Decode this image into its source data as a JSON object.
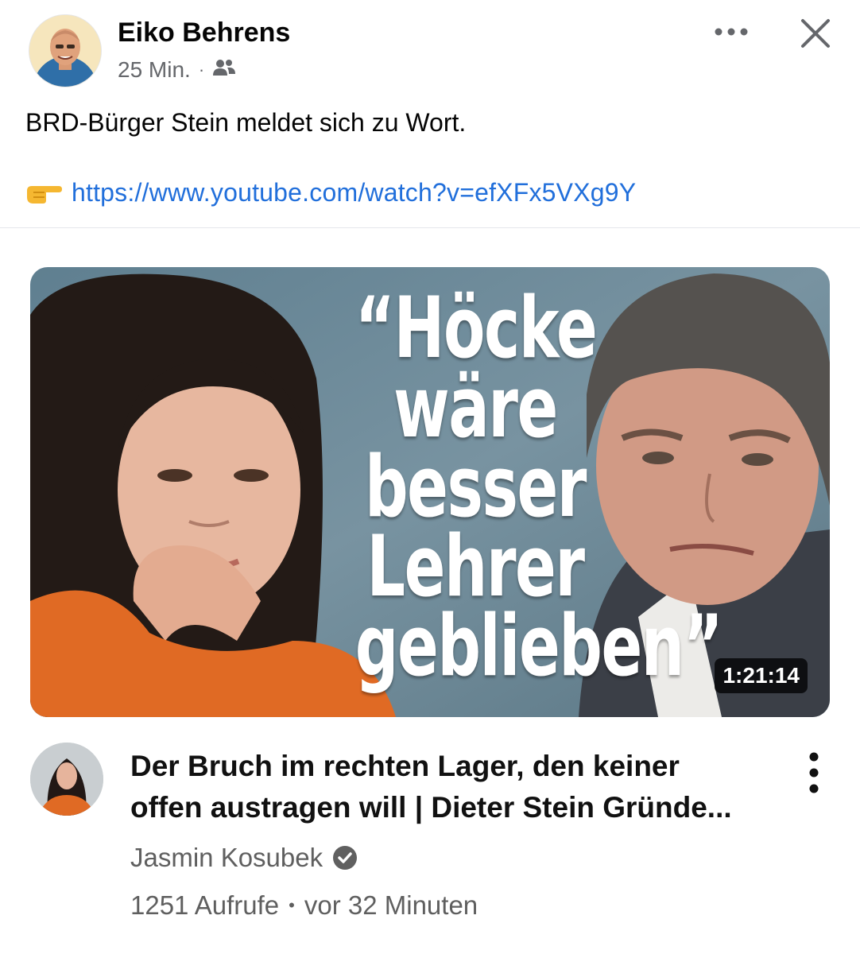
{
  "post": {
    "author": "Eiko Behrens",
    "time": "25 Min.",
    "separator": "·",
    "audience_icon": "friends-icon",
    "text": "BRD-Bürger Stein meldet sich zu Wort.",
    "link_icon": "pointing-hand-icon",
    "link_url": "https://www.youtube.com/watch?v=efXFx5VXg9Y"
  },
  "actions": {
    "more_icon": "more-horizontal-icon",
    "close_icon": "close-icon"
  },
  "video": {
    "thumbnail_text": {
      "line1": "“Höcke",
      "line2": "wäre",
      "line3": "besser",
      "line4": "Lehrer",
      "line5": "geblieben”"
    },
    "duration": "1:21:14",
    "title_line1": "Der Bruch im rechten Lager, den keiner",
    "title_line2": "offen austragen will | Dieter Stein Gründe...",
    "channel": "Jasmin Kosubek",
    "verified_icon": "verified-check-icon",
    "views": "1251 Aufrufe",
    "stats_separator": "•",
    "age": "vor 32 Minuten",
    "menu_icon": "more-vertical-icon"
  },
  "colors": {
    "link": "#216fdb",
    "meta_gray": "#65676b",
    "thumbnail_bg": "#6d8a9a",
    "sweater": "#e06a24"
  }
}
